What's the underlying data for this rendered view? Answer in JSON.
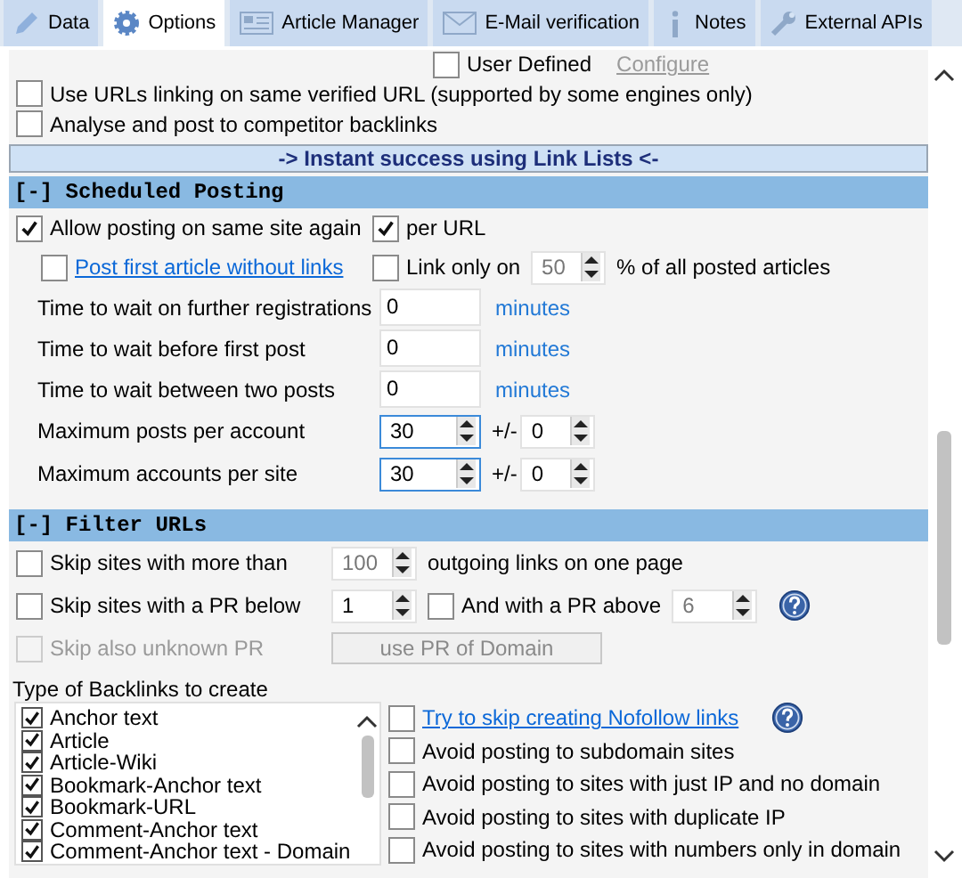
{
  "tabs": [
    {
      "label": "Data",
      "selected": false
    },
    {
      "label": "Options",
      "selected": true
    },
    {
      "label": "Article Manager",
      "selected": false
    },
    {
      "label": "E-Mail verification",
      "selected": false
    },
    {
      "label": "Notes",
      "selected": false
    },
    {
      "label": "External APIs",
      "selected": false
    }
  ],
  "user_defined": {
    "label": "User Defined",
    "checked": false,
    "configure": "Configure"
  },
  "top_options": [
    {
      "label": "Use URLs linking on same verified URL (supported by some engines only)",
      "checked": false
    },
    {
      "label": "Analyse and post to competitor backlinks",
      "checked": false
    }
  ],
  "banner": "-> Instant success using Link Lists <-",
  "scheduled": {
    "header": "[-] Scheduled Posting",
    "allow_same_site": {
      "label": "Allow posting on same site again",
      "checked": true
    },
    "per_url": {
      "label": "per URL",
      "checked": true
    },
    "post_first": {
      "label": "Post first article without links",
      "checked": false
    },
    "link_only": {
      "label": "Link only on",
      "checked": false,
      "value": "50",
      "value_disabled": true,
      "suffix": "% of all posted articles"
    },
    "waits": [
      {
        "label": "Time to wait on further registrations",
        "value": "0",
        "unit": "minutes"
      },
      {
        "label": "Time to wait before first post",
        "value": "0",
        "unit": "minutes"
      },
      {
        "label": "Time to wait between two posts",
        "value": "0",
        "unit": "minutes"
      }
    ],
    "maximums": [
      {
        "label": "Maximum posts per account",
        "value": "30",
        "plusminus": "+/-",
        "variance": "0"
      },
      {
        "label": "Maximum accounts per site",
        "value": "30",
        "plusminus": "+/-",
        "variance": "0"
      }
    ]
  },
  "filter": {
    "header": "[-] Filter URLs",
    "skip_more": {
      "label": "Skip sites with more than",
      "checked": false,
      "value": "100",
      "value_disabled": true,
      "suffix": "outgoing links on one page"
    },
    "skip_pr_below": {
      "label": "Skip sites with a PR below",
      "checked": false,
      "value": "1",
      "value_disabled": false
    },
    "pr_above": {
      "label": "And with a PR above",
      "checked": false,
      "value": "6",
      "value_disabled": true
    },
    "skip_unknown": {
      "label": "Skip also unknown PR",
      "checked": false,
      "disabled": true
    },
    "use_pr_button": "use PR of Domain",
    "types_label": "Type of Backlinks to create",
    "types": [
      {
        "label": "Anchor text",
        "checked": true
      },
      {
        "label": "Article",
        "checked": true
      },
      {
        "label": "Article-Wiki",
        "checked": true
      },
      {
        "label": "Bookmark-Anchor text",
        "checked": true
      },
      {
        "label": "Bookmark-URL",
        "checked": true
      },
      {
        "label": "Comment-Anchor text",
        "checked": true
      },
      {
        "label": "Comment-Anchor text - Domain",
        "checked": true
      }
    ],
    "nofollow": {
      "label": "Try to skip creating Nofollow links",
      "checked": false
    },
    "avoid": [
      {
        "label": "Avoid posting to subdomain sites",
        "checked": false
      },
      {
        "label": "Avoid posting to sites with just IP and no domain",
        "checked": false
      },
      {
        "label": "Avoid posting to sites with duplicate IP",
        "checked": false
      },
      {
        "label": "Avoid posting to sites with numbers only in domain",
        "checked": false
      }
    ]
  }
}
